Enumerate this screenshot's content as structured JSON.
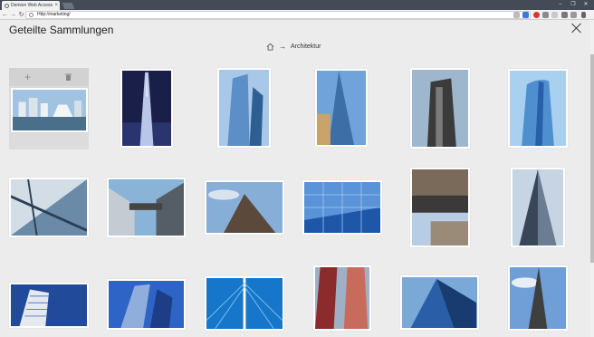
{
  "browser": {
    "tab_title": "Demion Web Access",
    "url_host": "Http://marketing/",
    "url_path": "",
    "nav_icons": [
      "back-icon",
      "forward-icon",
      "reload-icon"
    ],
    "window_controls": [
      "minimize-icon",
      "restore-icon",
      "close-icon"
    ]
  },
  "app": {
    "title": "Geteilte Sammlungen",
    "breadcrumb": {
      "home_icon": "home-icon",
      "separator": "→",
      "current": "Architektur"
    },
    "staging_tile": {
      "add_icon": "plus-icon",
      "delete_icon": "trash-icon",
      "add_symbol": "+"
    },
    "photos": [
      {
        "name": "sea-skyline",
        "palette": [
          "#8fb9d9",
          "#4a6f8b",
          "#e9eef2"
        ]
      },
      {
        "name": "burj-tower-night",
        "palette": [
          "#1a1f4a",
          "#2a3570",
          "#b9c6e8"
        ]
      },
      {
        "name": "blue-glass-tower",
        "palette": [
          "#5c8fc7",
          "#a9c8e8",
          "#2e5f93"
        ]
      },
      {
        "name": "shard-tower",
        "palette": [
          "#6fa3d9",
          "#3e6ea6",
          "#c8a46a"
        ]
      },
      {
        "name": "dark-office-tower",
        "palette": [
          "#9fb7cc",
          "#3b3b3b",
          "#7a7a7a"
        ]
      },
      {
        "name": "curved-glass-tower",
        "palette": [
          "#4f8fd0",
          "#a9d0ef",
          "#2760a8"
        ]
      },
      {
        "name": "glass-facade-diagonal",
        "palette": [
          "#6b8aa8",
          "#d3dde6",
          "#2a3f55"
        ]
      },
      {
        "name": "skybridge-buildings",
        "palette": [
          "#8ab3d8",
          "#555d66",
          "#c4cbd2"
        ]
      },
      {
        "name": "dark-tower-sky",
        "palette": [
          "#87aed6",
          "#5b4a3c",
          "#d8e3ee"
        ]
      },
      {
        "name": "blue-glass-grid",
        "palette": [
          "#1e56a8",
          "#5a93d8",
          "#a8cbf0"
        ]
      },
      {
        "name": "overpass-building",
        "palette": [
          "#7a6a5a",
          "#b7cde3",
          "#3c3a38"
        ]
      },
      {
        "name": "triangle-tower-up",
        "palette": [
          "#6b7c93",
          "#c7d4e3",
          "#384658"
        ]
      },
      {
        "name": "white-tower-blue",
        "palette": [
          "#214a9b",
          "#e6eaf0",
          "#4d78c4"
        ]
      },
      {
        "name": "curved-tower-blue",
        "palette": [
          "#2f64c7",
          "#8faedb",
          "#1d3d86"
        ]
      },
      {
        "name": "cable-bridge",
        "palette": [
          "#1676c9",
          "#7cc2ee",
          "#ffffff"
        ]
      },
      {
        "name": "red-stripe-towers",
        "palette": [
          "#8b2b2b",
          "#9fb0c4",
          "#c96b5c"
        ]
      },
      {
        "name": "glass-wedge-tower",
        "palette": [
          "#2a5fa8",
          "#7aa9d8",
          "#183c70"
        ]
      },
      {
        "name": "spire-tower-clouds",
        "palette": [
          "#6f9fd6",
          "#3f3f3f",
          "#e7eef6"
        ]
      }
    ]
  }
}
